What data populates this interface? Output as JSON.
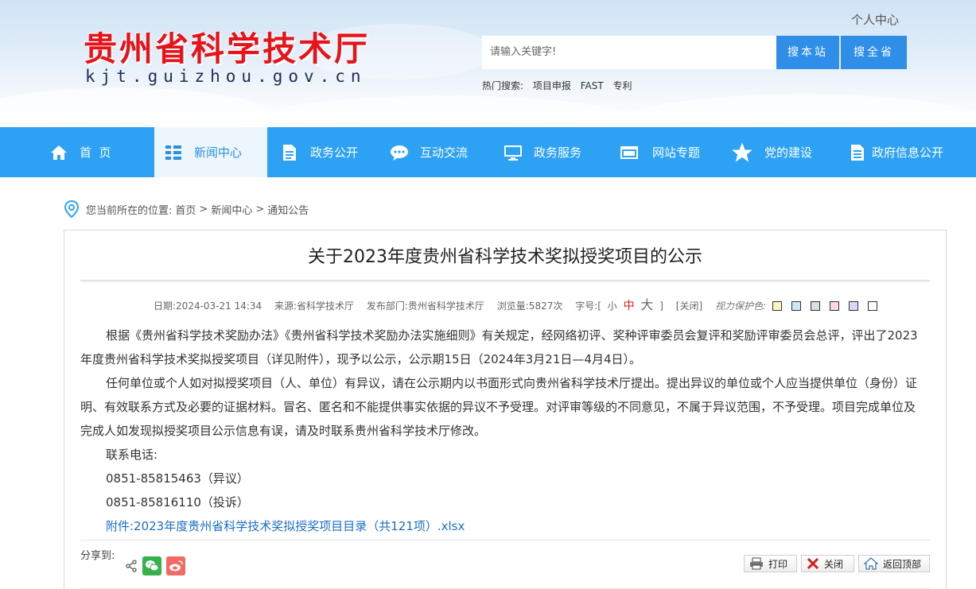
{
  "header": {
    "logo_cn": "贵州省科学技术厅",
    "logo_en": "kjt.guizhou.gov.cn",
    "personal_center": "个人中心",
    "search_placeholder": "请输入关键字!",
    "search_site": "搜本站",
    "search_province": "搜全省",
    "hot_label": "热门搜索:",
    "hot_items": [
      "项目申报",
      "FAST",
      "专利"
    ]
  },
  "nav": {
    "items": [
      {
        "label": "首  页",
        "icon": "home-icon"
      },
      {
        "label": "新闻中心",
        "icon": "news-grid-icon"
      },
      {
        "label": "政务公开",
        "icon": "document-icon"
      },
      {
        "label": "互动交流",
        "icon": "chat-bubble-icon"
      },
      {
        "label": "政务服务",
        "icon": "monitor-icon"
      },
      {
        "label": "网站专题",
        "icon": "folder-icon"
      },
      {
        "label": "党的建设",
        "icon": "star-icon"
      },
      {
        "label": "政府信息公开",
        "icon": "document-list-icon"
      }
    ],
    "active_index": 1
  },
  "breadcrumb": {
    "prefix": "您当前所在的位置:",
    "path": [
      "首页",
      "新闻中心",
      "通知公告"
    ],
    "separator": ">"
  },
  "article": {
    "title": "关于2023年度贵州省科学技术奖拟授奖项目的公示",
    "meta": {
      "date": "日期:2024-03-21 14:34",
      "source": "来源:省科学技术厅",
      "department": "发布部门:贵州省科学技术厅",
      "views": "浏览量:5827次",
      "font_label": "字号:[",
      "font_small": "小",
      "font_mid": "中",
      "font_big": "大",
      "font_end": "]",
      "close": "[关闭]",
      "eye_label": "视力保护色:",
      "eye_colors": [
        "#fdf5c4",
        "#cce8f6",
        "#d9dce6",
        "#fbd7e6",
        "#e2d4f5",
        "#ffffff"
      ]
    },
    "paragraphs": [
      "根据《贵州省科学技术奖励办法》《贵州省科学技术奖励办法实施细则》有关规定，经网络初评、奖种评审委员会复评和奖励评审委员会总评，评出了2023年度贵州省科学技术奖拟授奖项目（详见附件），现予以公示，公示期15日（2024年3月21日—4月4日）。",
      "任何单位或个人如对拟授奖项目（人、单位）有异议，请在公示期内以书面形式向贵州省科学技术厅提出。提出异议的单位或个人应当提供单位（身份）证明、有效联系方式及必要的证据材料。冒名、匿名和不能提供事实依据的异议不予受理。对评审等级的不同意见，不属于异议范围，不予受理。项目完成单位及完成人如发现拟授奖项目公示信息有误，请及时联系贵州省科学技术厅修改。"
    ],
    "contact_label": "联系电话:",
    "phone_objection": "0851-85815463（异议）",
    "phone_complaint": "0851-85816110（投诉）",
    "attachment": "附件:2023年度贵州省科学技术奖拟授奖项目目录（共121项）.xlsx"
  },
  "share": {
    "label": "分享到:",
    "print": "打印",
    "close": "关闭",
    "back_top": "返回顶部"
  },
  "colors": {
    "nav_bg": "#2da2f4",
    "search_btn": "#2e8ee8",
    "logo_red": "#e5141b",
    "link_blue": "#1a6fc4"
  }
}
